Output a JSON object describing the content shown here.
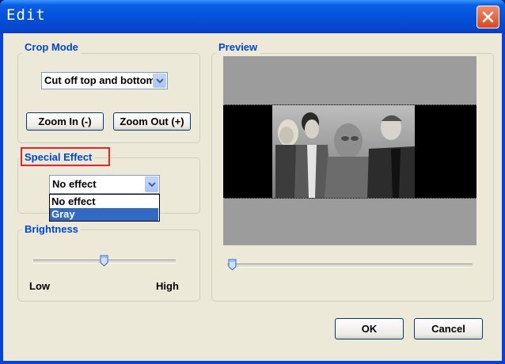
{
  "window": {
    "title": "Edit"
  },
  "crop_mode": {
    "label": "Crop Mode",
    "selected": "Cut off top and bottom",
    "zoom_in": "Zoom In (-)",
    "zoom_out": "Zoom Out (+)"
  },
  "special_effect": {
    "label": "Special Effect",
    "selected": "No effect",
    "options": [
      "No effect",
      "Gray"
    ],
    "highlighted_option": "Gray"
  },
  "brightness": {
    "label": "Brightness",
    "low": "Low",
    "high": "High",
    "value_fraction": 0.5
  },
  "preview": {
    "label": "Preview",
    "timeline_fraction": 0.0
  },
  "buttons": {
    "ok": "OK",
    "cancel": "Cancel"
  },
  "colors": {
    "title_bar": "#0552db",
    "accent_label": "#0046d5",
    "highlight": "#e8242a",
    "selection": "#316ac5"
  }
}
